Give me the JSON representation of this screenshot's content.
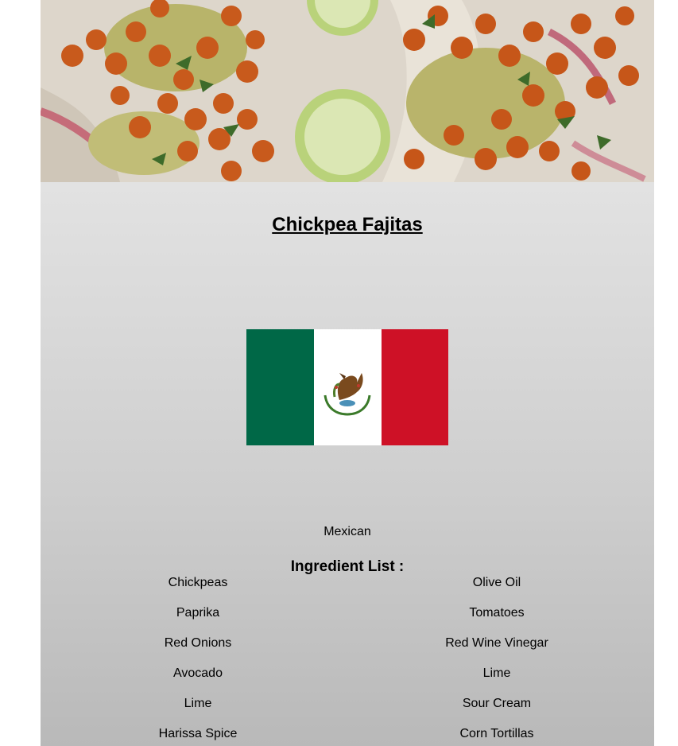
{
  "recipe": {
    "title": "Chickpea Fajitas",
    "hero_image": "chickpea-fajitas-photo",
    "flag": "mexico-flag",
    "cuisine": "Mexican"
  },
  "ingredients": {
    "heading": "Ingredient List :",
    "left": [
      "Chickpeas",
      "Paprika",
      "Red Onions",
      "Avocado",
      "Lime",
      "Harissa Spice"
    ],
    "right": [
      "Olive Oil",
      "Tomatoes",
      "Red Wine Vinegar",
      "Lime",
      "Sour Cream",
      "Corn Tortillas"
    ]
  },
  "colors": {
    "flag_green": "#006847",
    "flag_white": "#ffffff",
    "flag_red": "#ce1126"
  }
}
